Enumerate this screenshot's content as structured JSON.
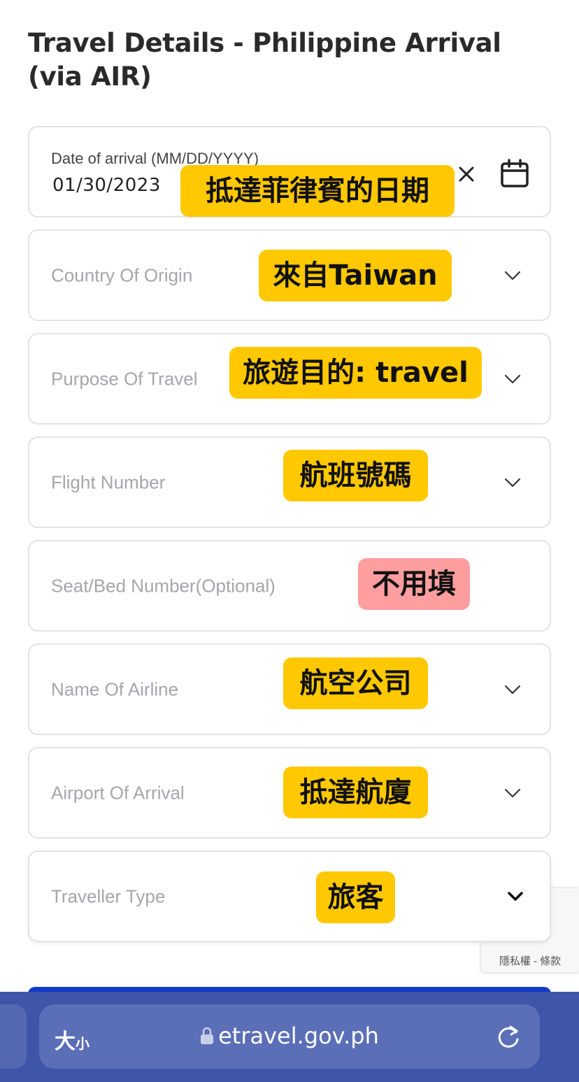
{
  "page": {
    "title": "Travel Details - Philippine Arrival (via AIR)"
  },
  "date_field": {
    "label": "Date of arrival (MM/DD/YYYY)",
    "value": "01/30/2023",
    "note": "抵達菲律賓的日期"
  },
  "fields": [
    {
      "placeholder": "Country Of Origin",
      "note": "來自Taiwan"
    },
    {
      "placeholder": "Purpose Of Travel",
      "note": "旅遊目的: travel"
    },
    {
      "placeholder": "Flight Number",
      "note": "航班號碼"
    },
    {
      "placeholder": "Seat/Bed Number(Optional)",
      "note": "不用填"
    },
    {
      "placeholder": "Name Of Airline",
      "note": "航空公司"
    },
    {
      "placeholder": "Airport Of Arrival",
      "note": "抵達航廈"
    },
    {
      "placeholder": "Traveller Type",
      "note": "旅客"
    }
  ],
  "recaptcha": {
    "links": "隱私權 - 條款"
  },
  "browser": {
    "text_size_big": "大",
    "text_size_small": "小",
    "url": "etravel.gov.ph"
  },
  "colors": {
    "note_yellow": "#ffc800",
    "note_pink": "#ff9e9e",
    "primary_button": "#1338c9",
    "browser_bar": "#3e55a8"
  }
}
